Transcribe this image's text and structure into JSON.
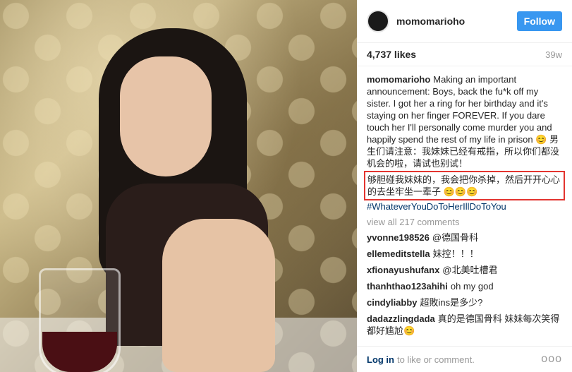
{
  "post": {
    "username": "momomarioho",
    "follow_label": "Follow",
    "likes": "4,737 likes",
    "age": "39w"
  },
  "caption": {
    "username": "momomarioho",
    "text_en": "Making an important announcement: Boys, back the fu*k off my sister. I got her a ring for her birthday and it's staying on her finger FOREVER. If you dare touch her I'll personally come murder you and happily spend the rest of my life in prison 😊",
    "text_cn_1": "男生们请注意：我妹妹已经有戒指，所以你们都没机会的啦，请试也别试！",
    "text_cn_highlight": "够胆碰我妹妹的，我会把你杀掉，然后开开心心的去坐牢坐一辈子 😊😊😊",
    "hashtag": "#WhateverYouDoToHerIllDoToYou"
  },
  "view_all": "view all 217 comments",
  "comments": [
    {
      "user": "yvonne198526",
      "text": "@德国骨科"
    },
    {
      "user": "ellemeditstella",
      "text": "妹控！！！"
    },
    {
      "user": "xfionayushufanx",
      "text": "@北美吐槽君"
    },
    {
      "user": "thanhthao123ahihi",
      "text": "oh my god"
    },
    {
      "user": "cindyliabby",
      "text": "超敗ins是多少?"
    },
    {
      "user": "dadazzlingdada",
      "text": "真的是德国骨科 妹妹每次笑得都好尴尬😊"
    }
  ],
  "footer": {
    "login": "Log in",
    "rest": "to like or comment.",
    "more": "ooo"
  }
}
